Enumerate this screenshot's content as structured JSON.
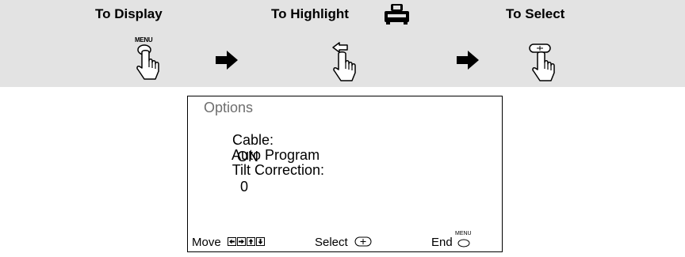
{
  "instructions": {
    "display_label": "To Display",
    "highlight_label": "To Highlight",
    "select_label": "To Select",
    "menu_button_text": "MENU"
  },
  "osd": {
    "title": "Options",
    "items": [
      {
        "label": "Cable:",
        "value": "ON"
      },
      {
        "label": "Auto Program"
      },
      {
        "label": "Tilt Correction:",
        "value": "0"
      }
    ],
    "footer": {
      "move_label": "Move",
      "select_label": "Select",
      "end_label": "End",
      "end_icon_text": "MENU"
    }
  },
  "colors": {
    "banner_background": "#e3e3e3",
    "title_gray": "#6e6e6e"
  },
  "icons": [
    "tv-icon",
    "menu-button-press-icon",
    "joystick-move-icon",
    "joystick-push-icon",
    "arrow-right-icon"
  ]
}
